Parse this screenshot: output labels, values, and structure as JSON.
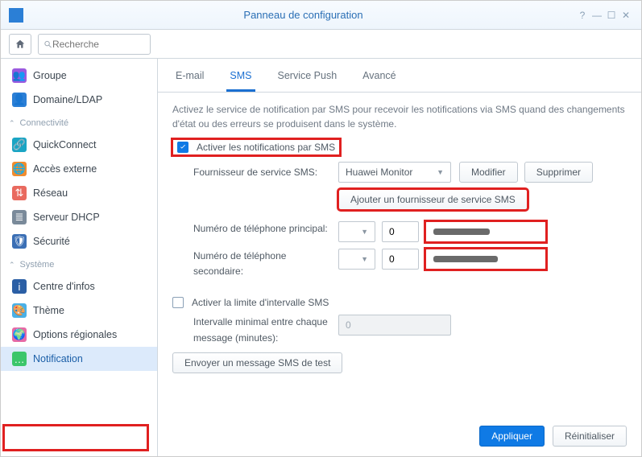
{
  "window": {
    "title": "Panneau de configuration"
  },
  "search": {
    "placeholder": "Recherche"
  },
  "sidebar": {
    "items_top": [
      {
        "label": "Groupe",
        "icon": "purple",
        "glyph": "👥"
      },
      {
        "label": "Domaine/LDAP",
        "icon": "blue",
        "glyph": "🗂"
      }
    ],
    "section1": {
      "title": "Connectivité"
    },
    "items_conn": [
      {
        "label": "QuickConnect",
        "icon": "teal",
        "glyph": "🔗"
      },
      {
        "label": "Accès externe",
        "icon": "orange",
        "glyph": "🌐"
      },
      {
        "label": "Réseau",
        "icon": "red",
        "glyph": "⇅"
      },
      {
        "label": "Serveur DHCP",
        "icon": "gray",
        "glyph": "≣"
      },
      {
        "label": "Sécurité",
        "icon": "darkblue",
        "glyph": "🛡"
      }
    ],
    "section2": {
      "title": "Système"
    },
    "items_sys": [
      {
        "label": "Centre d'infos",
        "icon": "navy",
        "glyph": "i"
      },
      {
        "label": "Thème",
        "icon": "sky",
        "glyph": "🎨"
      },
      {
        "label": "Options régionales",
        "icon": "pink",
        "glyph": "🌍"
      },
      {
        "label": "Notification",
        "icon": "green",
        "glyph": "✉"
      }
    ]
  },
  "tabs": {
    "email": "E-mail",
    "sms": "SMS",
    "push": "Service Push",
    "advanced": "Avancé"
  },
  "sms": {
    "desc": "Activez le service de notification par SMS pour recevoir les notifications via SMS quand des changements d'état ou des erreurs se produisent dans le système.",
    "enable_label": "Activer les notifications par SMS",
    "provider_label": "Fournisseur de service SMS:",
    "provider_value": "Huawei Monitor",
    "modify": "Modifier",
    "delete": "Supprimer",
    "add_provider": "Ajouter un fournisseur de service SMS",
    "primary_label": "Numéro de téléphone principal:",
    "secondary_label": "Numéro de téléphone secondaire:",
    "prefix_value": "0",
    "interval_enable": "Activer la limite d'intervalle SMS",
    "interval_label": "Intervalle minimal entre chaque message (minutes):",
    "interval_value": "0",
    "test_btn": "Envoyer un message SMS de test",
    "apply": "Appliquer",
    "reset": "Réinitialiser"
  }
}
